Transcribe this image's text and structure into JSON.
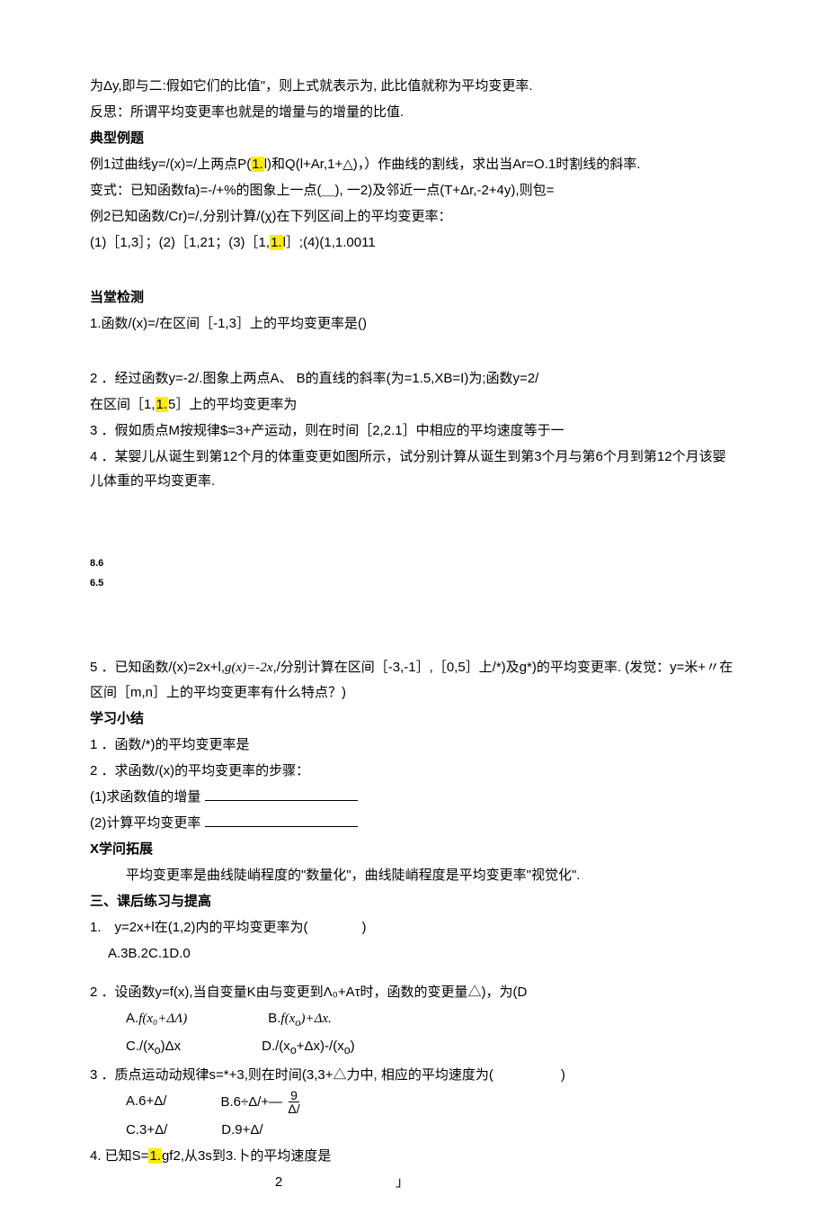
{
  "lines": {
    "l1": "为Δy,即与二:假如它们的比值\"，则上式就表示为, 此比值就称为平均变更率.",
    "l2": "反思：所谓平均变更率也就是的增量与的增量的比值.",
    "h1": "典型例题",
    "l3a": "例1过曲线y=/(x)=/上两点P(",
    "l3hl": "1.",
    "l3b": "l)和Q(l+Ar,1+△)，）作曲线的割线，求出当Ar=O.1时割线的斜率.",
    "l4": "变式：已知函数fa)=-/+%的图象上一点(＿), 一2)及邻近一点(T+Δr,-2+4y),则包=",
    "l5": "例2已知函数/Cr)=/,分别计算/(χ)在下列区间上的平均变更率：",
    "l6a": "(1)［1,3］；(2)［1,21；(3)［1,",
    "l6hl": "1.",
    "l6b": "l］;(4)(1,1.0011",
    "h2": "当堂检测",
    "l7": "1.函数/(x)=/在区间［-1,3］上的平均变更率是()",
    "l8": "2 ．经过函数y=-2/.图象上两点A、 B的直线的斜率(为=1.5,XB=I)为;函数y=2/",
    "l9a": "在区间［1,",
    "l9hl": "1.",
    "l9b": "5］上的平均变更率为",
    "l10": "3 ．假如质点M按规律$=3+产运动，则在时间［2,2.1］中相应的平均速度等于一",
    "l11": "4 ．某婴儿从诞生到第12个月的体重变更如图所示，试分别计算从诞生到第3个月与第6个月到第12个月该婴儿体重的平均变更率.",
    "v1": "8.6",
    "v2": "6.5",
    "l12a": "5 ．已知函数/(x)=2x+l,",
    "l12it": "g(x)=-2x",
    "l12b": ",/分别计算在区间［-3,-1］,［0,5］上/*)及g*)的平均变更率. (发觉：y=米+〃在区间［m,n］上的平均变更率有什么特点？)",
    "h3": "学习小结",
    "l13": "1 ．函数/*)的平均变更率是",
    "l14": "2 ．求函数/(x)的平均变更率的步骤：",
    "l15": "(1)求函数值的增量",
    "l16": "(2)计算平均变更率",
    "h4": "X学问拓展",
    "l17": "平均变更率是曲线陡峭程度的\"数量化\"，曲线陡峭程度是平均变更率\"视觉化\".",
    "h5": "三、课后练习与提高",
    "l18": "1.　y=2x+l在(1,2)内的平均变更率为(　　　　)",
    "l19": "A.3B.2C.1D.0",
    "l20": "2 ．设函数y=f(x),当自变量K由与变更到Λ₀+Ατ时，函数的变更量△)，为(D",
    "optA1a": "A.",
    "optA1b": "f(x₀+ΔΛ)",
    "optB1a": "B.",
    "optB1b": "f(x",
    "optB1c": ")+Δx.",
    "optC1": "C./(x",
    "optC1b": ")Δx",
    "optD1": "D./(x",
    "optD1b": "+Δx)-/(x",
    "optD1c": ")",
    "l21": "3 ．质点运动动规律s=*+3,则在时间(3,3+△力中, 相应的平均速度为(　　　　　)",
    "optA2": "A.6+Δ/",
    "optB2": "B.6÷Δ/+—",
    "fracn": "9",
    "fracd": "Δ/",
    "optC2": "C.3+Δ/",
    "optD2": "D.9+Δ/",
    "l22a": "4. 已知S=",
    "l22hl": "1.",
    "l22b": "gf2,从3s到3.卜的平均速度是",
    "bottom2": "2",
    "bottomb": "」"
  }
}
